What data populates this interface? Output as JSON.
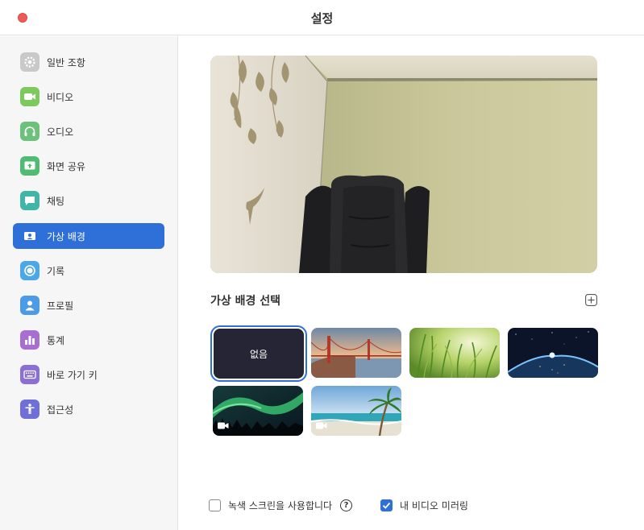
{
  "window": {
    "title": "설정"
  },
  "sidebar": {
    "items": [
      {
        "label": "일반 조항",
        "icon": "gear-icon",
        "color": "#9a9a9a",
        "active": false
      },
      {
        "label": "비디오",
        "icon": "video-camera-icon",
        "color": "#7dc95e",
        "active": false
      },
      {
        "label": "오디오",
        "icon": "headphones-icon",
        "color": "#6cc27a",
        "active": false
      },
      {
        "label": "화면 공유",
        "icon": "share-screen-icon",
        "color": "#4fbb73",
        "active": false
      },
      {
        "label": "채팅",
        "icon": "chat-icon",
        "color": "#3fb6a8",
        "active": false
      },
      {
        "label": "가상 배경",
        "icon": "virtual-background-icon",
        "color": "#2f6fd8",
        "active": true
      },
      {
        "label": "기록",
        "icon": "record-icon",
        "color": "#4aa8e8",
        "active": false
      },
      {
        "label": "프로필",
        "icon": "profile-icon",
        "color": "#4b9be6",
        "active": false
      },
      {
        "label": "통계",
        "icon": "statistics-icon",
        "color": "#a86fd0",
        "active": false
      },
      {
        "label": "바로 가기 키",
        "icon": "keyboard-icon",
        "color": "#8c6fd4",
        "active": false
      },
      {
        "label": "접근성",
        "icon": "accessibility-icon",
        "color": "#6f6fd8",
        "active": false
      }
    ]
  },
  "main": {
    "section_title": "가상 배경 선택",
    "backgrounds": [
      {
        "label": "없음",
        "type": "none",
        "selected": true,
        "video": false
      },
      {
        "label": "",
        "type": "golden-gate-bridge",
        "selected": false,
        "video": false
      },
      {
        "label": "",
        "type": "grass",
        "selected": false,
        "video": false
      },
      {
        "label": "",
        "type": "earth-from-space",
        "selected": false,
        "video": false
      },
      {
        "label": "",
        "type": "aurora",
        "selected": false,
        "video": true
      },
      {
        "label": "",
        "type": "beach",
        "selected": false,
        "video": true
      }
    ],
    "options": {
      "green_screen_label": "녹색 스크린을 사용합니다",
      "green_screen_checked": false,
      "help_glyph": "?",
      "mirror_label": "내 비디오 미러링",
      "mirror_checked": true
    }
  },
  "colors": {
    "accent": "#2f6fd8",
    "close": "#ee5b56"
  }
}
